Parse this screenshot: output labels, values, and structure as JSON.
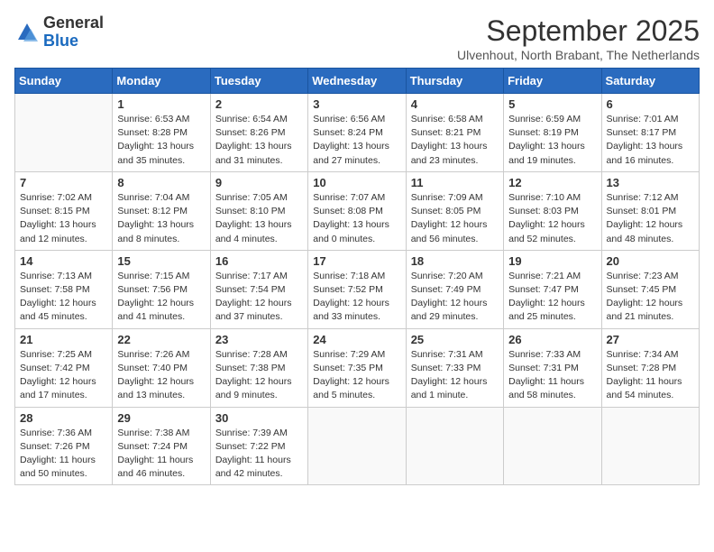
{
  "header": {
    "logo_general": "General",
    "logo_blue": "Blue",
    "month_year": "September 2025",
    "location": "Ulvenhout, North Brabant, The Netherlands"
  },
  "days_of_week": [
    "Sunday",
    "Monday",
    "Tuesday",
    "Wednesday",
    "Thursday",
    "Friday",
    "Saturday"
  ],
  "weeks": [
    [
      {
        "day": "",
        "info": ""
      },
      {
        "day": "1",
        "info": "Sunrise: 6:53 AM\nSunset: 8:28 PM\nDaylight: 13 hours\nand 35 minutes."
      },
      {
        "day": "2",
        "info": "Sunrise: 6:54 AM\nSunset: 8:26 PM\nDaylight: 13 hours\nand 31 minutes."
      },
      {
        "day": "3",
        "info": "Sunrise: 6:56 AM\nSunset: 8:24 PM\nDaylight: 13 hours\nand 27 minutes."
      },
      {
        "day": "4",
        "info": "Sunrise: 6:58 AM\nSunset: 8:21 PM\nDaylight: 13 hours\nand 23 minutes."
      },
      {
        "day": "5",
        "info": "Sunrise: 6:59 AM\nSunset: 8:19 PM\nDaylight: 13 hours\nand 19 minutes."
      },
      {
        "day": "6",
        "info": "Sunrise: 7:01 AM\nSunset: 8:17 PM\nDaylight: 13 hours\nand 16 minutes."
      }
    ],
    [
      {
        "day": "7",
        "info": "Sunrise: 7:02 AM\nSunset: 8:15 PM\nDaylight: 13 hours\nand 12 minutes."
      },
      {
        "day": "8",
        "info": "Sunrise: 7:04 AM\nSunset: 8:12 PM\nDaylight: 13 hours\nand 8 minutes."
      },
      {
        "day": "9",
        "info": "Sunrise: 7:05 AM\nSunset: 8:10 PM\nDaylight: 13 hours\nand 4 minutes."
      },
      {
        "day": "10",
        "info": "Sunrise: 7:07 AM\nSunset: 8:08 PM\nDaylight: 13 hours\nand 0 minutes."
      },
      {
        "day": "11",
        "info": "Sunrise: 7:09 AM\nSunset: 8:05 PM\nDaylight: 12 hours\nand 56 minutes."
      },
      {
        "day": "12",
        "info": "Sunrise: 7:10 AM\nSunset: 8:03 PM\nDaylight: 12 hours\nand 52 minutes."
      },
      {
        "day": "13",
        "info": "Sunrise: 7:12 AM\nSunset: 8:01 PM\nDaylight: 12 hours\nand 48 minutes."
      }
    ],
    [
      {
        "day": "14",
        "info": "Sunrise: 7:13 AM\nSunset: 7:58 PM\nDaylight: 12 hours\nand 45 minutes."
      },
      {
        "day": "15",
        "info": "Sunrise: 7:15 AM\nSunset: 7:56 PM\nDaylight: 12 hours\nand 41 minutes."
      },
      {
        "day": "16",
        "info": "Sunrise: 7:17 AM\nSunset: 7:54 PM\nDaylight: 12 hours\nand 37 minutes."
      },
      {
        "day": "17",
        "info": "Sunrise: 7:18 AM\nSunset: 7:52 PM\nDaylight: 12 hours\nand 33 minutes."
      },
      {
        "day": "18",
        "info": "Sunrise: 7:20 AM\nSunset: 7:49 PM\nDaylight: 12 hours\nand 29 minutes."
      },
      {
        "day": "19",
        "info": "Sunrise: 7:21 AM\nSunset: 7:47 PM\nDaylight: 12 hours\nand 25 minutes."
      },
      {
        "day": "20",
        "info": "Sunrise: 7:23 AM\nSunset: 7:45 PM\nDaylight: 12 hours\nand 21 minutes."
      }
    ],
    [
      {
        "day": "21",
        "info": "Sunrise: 7:25 AM\nSunset: 7:42 PM\nDaylight: 12 hours\nand 17 minutes."
      },
      {
        "day": "22",
        "info": "Sunrise: 7:26 AM\nSunset: 7:40 PM\nDaylight: 12 hours\nand 13 minutes."
      },
      {
        "day": "23",
        "info": "Sunrise: 7:28 AM\nSunset: 7:38 PM\nDaylight: 12 hours\nand 9 minutes."
      },
      {
        "day": "24",
        "info": "Sunrise: 7:29 AM\nSunset: 7:35 PM\nDaylight: 12 hours\nand 5 minutes."
      },
      {
        "day": "25",
        "info": "Sunrise: 7:31 AM\nSunset: 7:33 PM\nDaylight: 12 hours\nand 1 minute."
      },
      {
        "day": "26",
        "info": "Sunrise: 7:33 AM\nSunset: 7:31 PM\nDaylight: 11 hours\nand 58 minutes."
      },
      {
        "day": "27",
        "info": "Sunrise: 7:34 AM\nSunset: 7:28 PM\nDaylight: 11 hours\nand 54 minutes."
      }
    ],
    [
      {
        "day": "28",
        "info": "Sunrise: 7:36 AM\nSunset: 7:26 PM\nDaylight: 11 hours\nand 50 minutes."
      },
      {
        "day": "29",
        "info": "Sunrise: 7:38 AM\nSunset: 7:24 PM\nDaylight: 11 hours\nand 46 minutes."
      },
      {
        "day": "30",
        "info": "Sunrise: 7:39 AM\nSunset: 7:22 PM\nDaylight: 11 hours\nand 42 minutes."
      },
      {
        "day": "",
        "info": ""
      },
      {
        "day": "",
        "info": ""
      },
      {
        "day": "",
        "info": ""
      },
      {
        "day": "",
        "info": ""
      }
    ]
  ]
}
